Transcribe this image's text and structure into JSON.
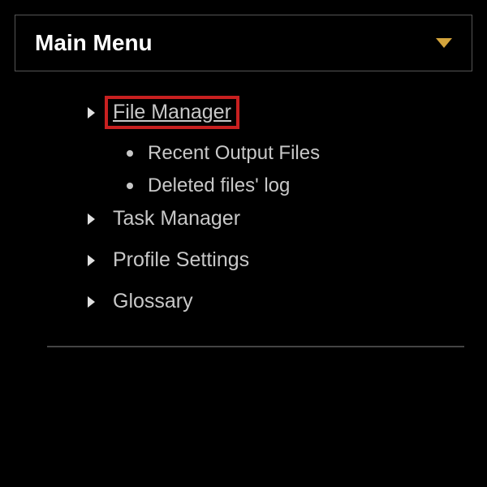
{
  "header": {
    "title": "Main Menu"
  },
  "menu": {
    "items": [
      {
        "label": "File Manager",
        "highlighted": true,
        "subitems": [
          {
            "label": "Recent Output Files"
          },
          {
            "label": "Deleted files' log"
          }
        ]
      },
      {
        "label": "Task Manager"
      },
      {
        "label": "Profile Settings"
      },
      {
        "label": "Glossary"
      }
    ]
  }
}
